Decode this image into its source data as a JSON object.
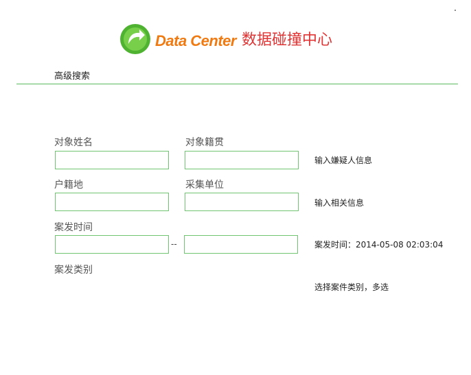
{
  "brand": {
    "name_en": "Data Center",
    "name_cn": "数据碰撞中心",
    "colors": {
      "logo_green": "#5cbf3c",
      "name_en": "#f07a12",
      "name_cn": "#e03333",
      "field_border": "#6fc56f"
    }
  },
  "page": {
    "title": "高级搜索"
  },
  "form": {
    "target_name_label": "对象姓名",
    "target_origin_label": "对象籍贯",
    "suspect_hint": "输入嫌疑人信息",
    "household_label": "户籍地",
    "collect_unit_label": "采集单位",
    "related_hint": "输入相关信息",
    "case_time_label": "案发时间",
    "range_separator": "--",
    "case_time_hint": "案发时间：2014-05-08 02:03:04",
    "case_category_label": "案发类别",
    "category_hint": "选择案件类别，多选",
    "fields": {
      "target_name": {
        "value": "",
        "placeholder": ""
      },
      "target_origin": {
        "value": "",
        "placeholder": ""
      },
      "household": {
        "value": "",
        "placeholder": ""
      },
      "collect_unit": {
        "value": "",
        "placeholder": ""
      },
      "case_time_start": {
        "value": "",
        "placeholder": ""
      },
      "case_time_end": {
        "value": "",
        "placeholder": ""
      }
    }
  }
}
